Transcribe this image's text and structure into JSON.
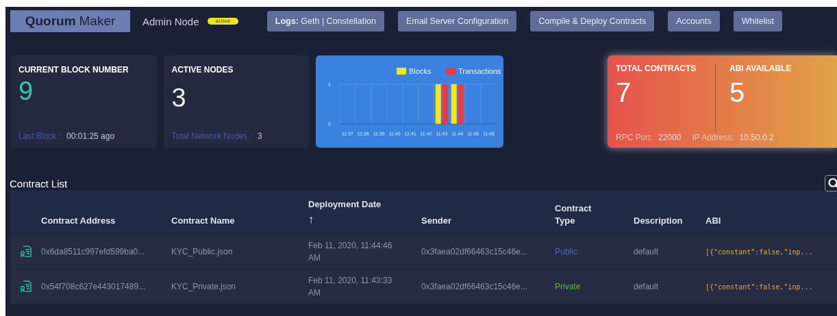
{
  "header": {
    "logo": {
      "bold": "Quorum",
      "light": "Maker"
    },
    "node_name": "Admin Node",
    "status_badge": "active",
    "buttons": [
      {
        "bold": "Logs:",
        "label": "Geth | Constellation"
      },
      {
        "label": "Email Server Configuration"
      },
      {
        "label": "Compile & Deploy Contracts"
      },
      {
        "label": "Accounts"
      },
      {
        "label": "Whitelist"
      }
    ]
  },
  "stats": [
    {
      "title": "CURRENT BLOCK NUMBER",
      "value": "9",
      "kind": "accent",
      "footer_label": "Last Block :",
      "footer_value": "00:01:25 ago"
    },
    {
      "title": "ACTIVE NODES",
      "value": "3",
      "kind": "plain",
      "footer_label": "Total Network Nodes :",
      "footer_value": "3"
    }
  ],
  "chart_data": {
    "type": "bar",
    "categories": [
      "11:37",
      "11:38",
      "11:39",
      "11:40",
      "11:41",
      "11:42",
      "11:43",
      "11:44",
      "11:45",
      "11:46"
    ],
    "series": [
      {
        "name": "Blocks",
        "color": "#f5e614",
        "values": [
          0,
          0,
          0,
          0,
          0,
          0,
          1,
          1,
          0,
          0
        ]
      },
      {
        "name": "Transactions",
        "color": "#f0393f",
        "values": [
          0,
          0,
          0,
          0,
          0,
          0,
          1,
          1,
          0,
          0
        ]
      }
    ],
    "ylim": [
      0,
      1
    ],
    "yticks": [
      0,
      1
    ],
    "legend": "top"
  },
  "contracts_card": {
    "sections": [
      {
        "title": "TOTAL CONTRACTS",
        "value": "7"
      },
      {
        "title": "ABI AVAILABLE",
        "value": "5"
      }
    ],
    "info": [
      {
        "label": "RPC Port:",
        "value": "22000"
      },
      {
        "label": "IP Address:",
        "value": "10.50.0.2"
      }
    ]
  },
  "contract_list": {
    "title": "Contract List",
    "columns": [
      {
        "label": "Contract Address"
      },
      {
        "label": "Contract Name"
      },
      {
        "label": "Deployment Date",
        "sort_arrow": "↑"
      },
      {
        "label": "Sender"
      },
      {
        "label": "Contract Type"
      },
      {
        "label": "Description"
      },
      {
        "label": "ABI"
      }
    ],
    "rows": [
      {
        "address": "0x6da8511c997efd599ba0...",
        "name": "KYC_Public.json",
        "date": "Feb 11, 2020, 11:44:46 AM",
        "sender": "0x3faea02df66463c15c46e...",
        "type": "Public",
        "color": "#4a63c8",
        "description": "default",
        "abi": "[{\"constant\":false,\"inp..."
      },
      {
        "address": "0x54f708c627e443017489...",
        "name": "KYC_Private.json",
        "date": "Feb 11, 2020, 11:43:33 AM",
        "sender": "0x3faea02df66463c15c46e...",
        "type": "Private",
        "color": "#5fb63a",
        "description": "default",
        "abi": "[{\"constant\":false,\"inp..."
      }
    ]
  }
}
